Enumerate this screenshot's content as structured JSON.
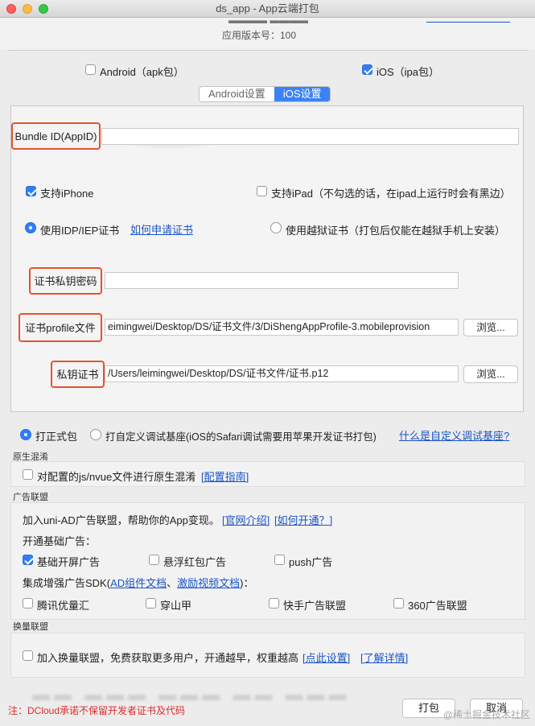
{
  "window": {
    "title": "ds_app - App云端打包"
  },
  "header": {
    "version_label": "应用版本号：100"
  },
  "platforms": {
    "android_label": "Android（apk包）",
    "android_checked": false,
    "ios_label": "iOS（ipa包）",
    "ios_checked": true
  },
  "tabs": [
    {
      "label": "Android设置",
      "active": false
    },
    {
      "label": "iOS设置",
      "active": true
    }
  ],
  "ios": {
    "bundle_id_label": "Bundle ID(AppID)",
    "bundle_id_value": "",
    "support_iphone_label": "支持iPhone",
    "support_iphone_checked": true,
    "support_ipad_label": "支持iPad（不勾选的话，在ipad上运行时会有黑边）",
    "support_ipad_checked": false,
    "cert_idp_label": "使用IDP/IEP证书",
    "cert_apply_link": "如何申请证书",
    "cert_jailbreak_label": "使用越狱证书（打包后仅能在越狱手机上安装）",
    "cert_password_label": "证书私钥密码",
    "cert_password_value": "",
    "profile_label": "证书profile文件",
    "profile_value": "eimingwei/Desktop/DS/证书文件/3/DiShengAppProfile-3.mobileprovision",
    "browse_label": "浏览...",
    "private_key_label": "私钥证书",
    "private_key_value": "/Users/leimingwei/Desktop/DS/证书文件/证书.p12"
  },
  "package_type": {
    "formal_label": "打正式包",
    "custom_label": "打自定义调试基座(iOS的Safari调试需要用苹果开发证书打包)",
    "custom_link": "什么是自定义调试基座?"
  },
  "obfuscation": {
    "section": "原生混淆",
    "option_label": "对配置的js/nvue文件进行原生混淆",
    "guide_link": "[配置指南]"
  },
  "ads": {
    "section": "广告联盟",
    "intro": "加入uni-AD广告联盟，帮助你的App变现。",
    "intro_link1": "[官网介绍]",
    "intro_link2": "[如何开通？]",
    "basic_title": "开通基础广告：",
    "basic_items": [
      {
        "label": "基础开屏广告",
        "checked": true
      },
      {
        "label": "悬浮红包广告",
        "checked": false
      },
      {
        "label": "push广告",
        "checked": false
      }
    ],
    "sdk_title_prefix": "集成增强广告SDK(",
    "sdk_link1": "AD组件文档",
    "sdk_sep": "、",
    "sdk_link2": "激励视频文档",
    "sdk_title_suffix": ")：",
    "sdk_items": [
      {
        "label": "腾讯优量汇",
        "checked": false
      },
      {
        "label": "穿山甲",
        "checked": false
      },
      {
        "label": "快手广告联盟",
        "checked": false
      },
      {
        "label": "360广告联盟",
        "checked": false
      }
    ]
  },
  "exchange": {
    "section": "换量联盟",
    "option_label": "加入换量联盟，免费获取更多用户，开通越早，权重越高",
    "link1": "[点此设置]",
    "link2": "[了解详情]"
  },
  "footer": {
    "notice": "注：DCloud承诺不保留开发者证书及代码",
    "pack_label": "打包",
    "cancel_label": "取消",
    "watermark": "@稀土掘金技术社区"
  }
}
